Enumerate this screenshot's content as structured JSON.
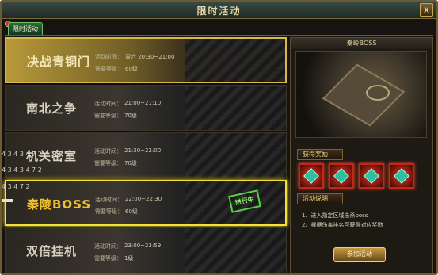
{
  "window": {
    "title": "限时活动",
    "close_label": "x"
  },
  "tabs": [
    {
      "label": "限时活动"
    }
  ],
  "activities": [
    {
      "name": "决战青铜门",
      "time_label": "活动时间：",
      "time": "周六 20:30~21:00",
      "level_label": "需要等级：",
      "level": "60级"
    },
    {
      "name": "南北之争",
      "time_label": "活动时间：",
      "time": "21:00~21:10",
      "level_label": "需要等级：",
      "level": "70级"
    },
    {
      "name": "机关密室",
      "time_label": "活动时间：",
      "time": "21:30~22:00",
      "level_label": "需要等级：",
      "level": "70级"
    },
    {
      "name": "秦陵BOSS",
      "time_label": "活动时间：",
      "time": "22:00~22:30",
      "level_label": "需要等级：",
      "level": "60级",
      "stamp": "进行中"
    },
    {
      "name": "双倍挂机",
      "time_label": "活动时间：",
      "time": "23:00~23:59",
      "level_label": "需要等级：",
      "level": "1级"
    }
  ],
  "overlay_marks": [
    "4 3 4 3 4 7 2",
    "4 3 4 3 4 7 2",
    "4 3 4 7 2"
  ],
  "detail": {
    "title": "秦岭BOSS",
    "reward_label": "获得奖励",
    "desc_label": "活动说明",
    "desc_lines": [
      "1、进入指定区域击杀boss",
      "2、根据伤害排名可获得对应奖励"
    ],
    "join_button": "参加活动"
  }
}
